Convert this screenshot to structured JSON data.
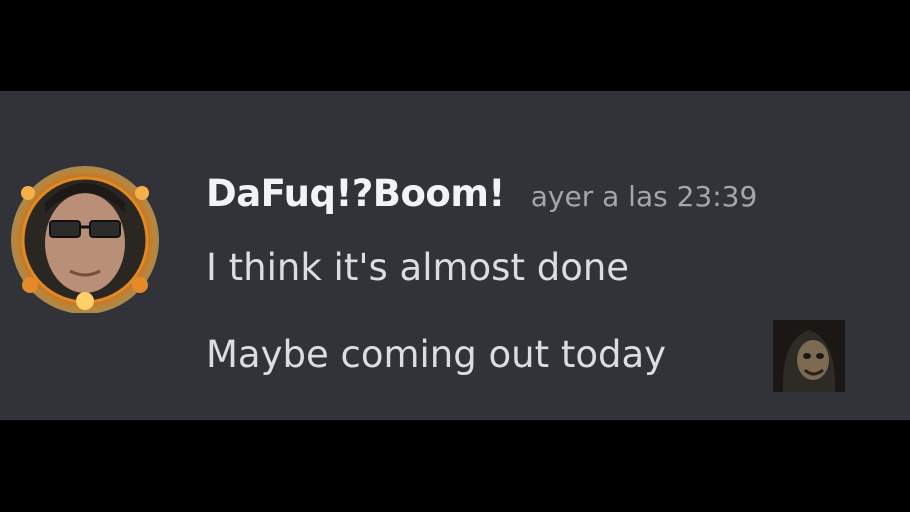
{
  "message": {
    "author": "DaFuq!?Boom!",
    "timestamp": "ayer a las 23:39",
    "lines": [
      "I think it's almost done",
      "Maybe coming out today"
    ],
    "avatar": "user-avatar-image",
    "inline_emoji": "custom-emoji-image"
  },
  "colors": {
    "background_outer": "#000000",
    "message_panel": "#313338",
    "username": "#f2f3f5",
    "timestamp": "#a3a6aa",
    "message_text": "#dbdee1",
    "avatar_decoration": "#f5a623"
  }
}
